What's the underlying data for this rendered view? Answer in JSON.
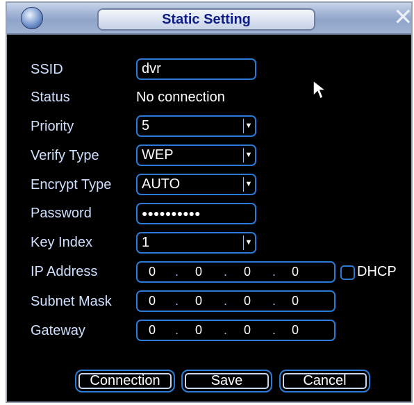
{
  "dialog": {
    "title": "Static Setting",
    "close_glyph": "✕",
    "logo_icon": "globe-icon"
  },
  "form": {
    "ssid_label": "SSID",
    "ssid_value": "dvr",
    "status_label": "Status",
    "status_value": "No connection",
    "priority_label": "Priority",
    "priority_value": "5",
    "verify_type_label": "Verify Type",
    "verify_type_value": "WEP",
    "encrypt_type_label": "Encrypt Type",
    "encrypt_type_value": "AUTO",
    "password_label": "Password",
    "password_value": "●●●●●●●●●●",
    "key_index_label": "Key Index",
    "key_index_value": "1",
    "ip_label": "IP Address",
    "ip_octets": [
      "0",
      "0",
      "0",
      "0"
    ],
    "dhcp_label": "DHCP",
    "subnet_label": "Subnet Mask",
    "subnet_octets": [
      "0",
      "0",
      "0",
      "0"
    ],
    "gateway_label": "Gateway",
    "gateway_octets": [
      "0",
      "0",
      "0",
      "0"
    ]
  },
  "buttons": {
    "connection": "Connection",
    "save": "Save",
    "cancel": "Cancel"
  },
  "colors": {
    "accent": "#2b7bd6",
    "label": "#cfe0ff",
    "title_text": "#0e1d86"
  }
}
